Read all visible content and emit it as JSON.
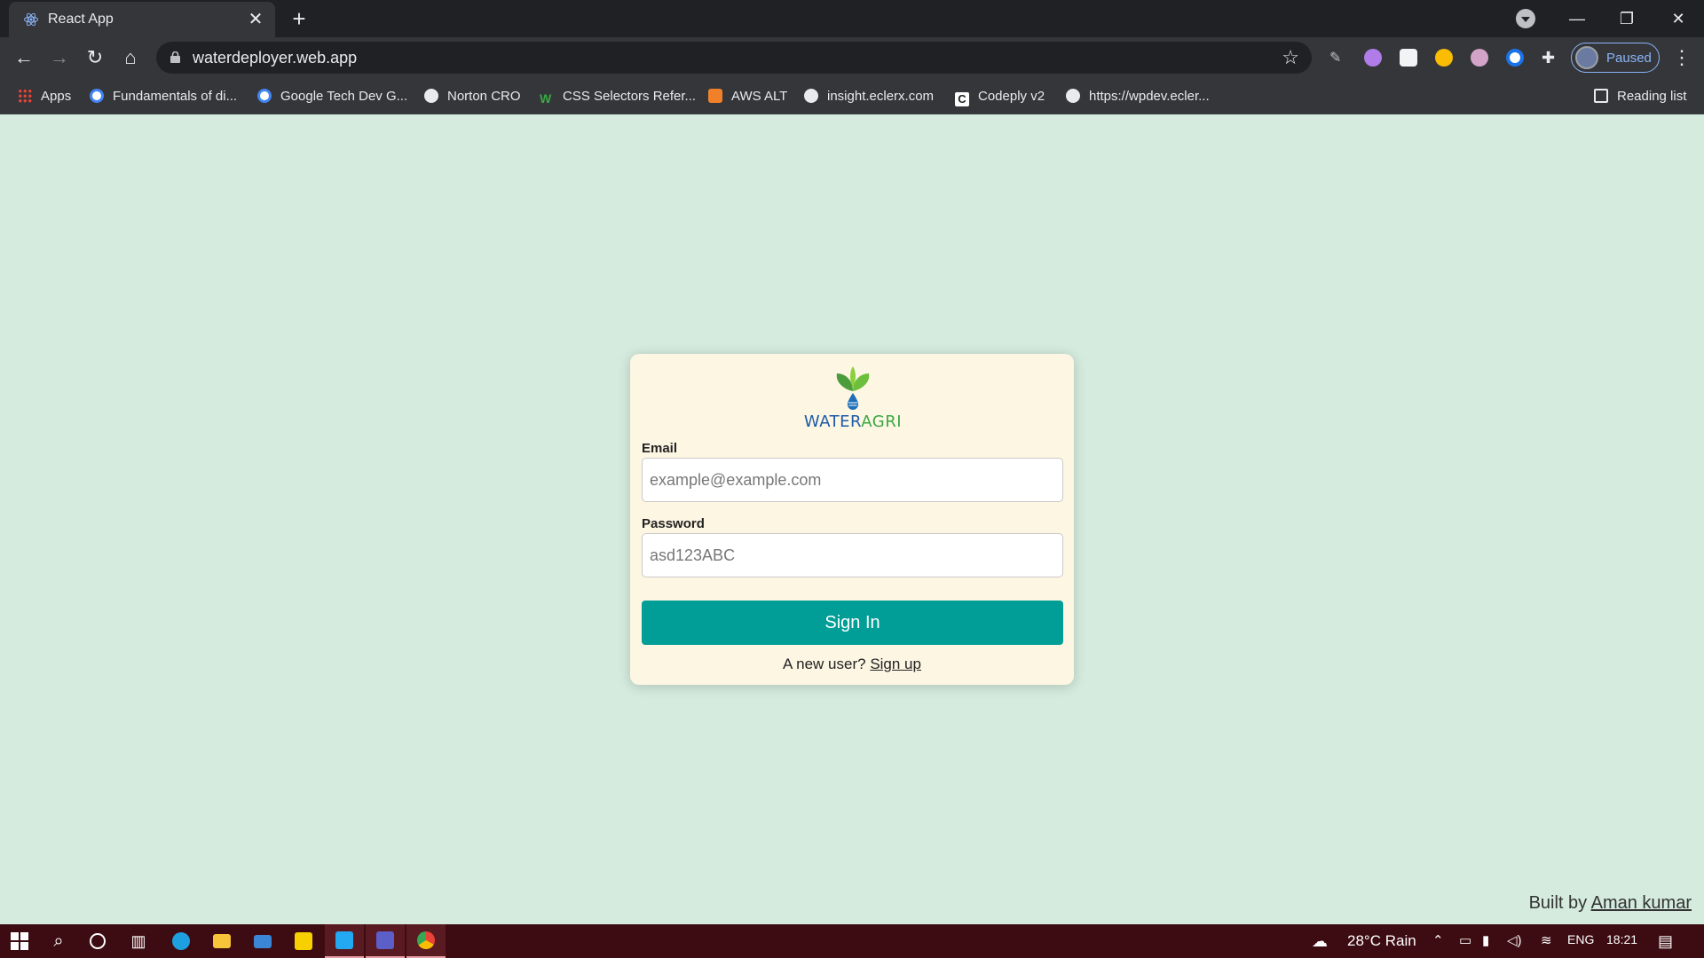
{
  "browser": {
    "tab_title": "React App",
    "tab_close": "✕",
    "new_tab": "+",
    "url": "waterdeployer.web.app",
    "profile_status": "Paused",
    "bookmarks": [
      {
        "label": "Apps",
        "icon": "apps-grid-icon"
      },
      {
        "label": "Fundamentals of di...",
        "icon": "google-icon"
      },
      {
        "label": "Google Tech Dev G...",
        "icon": "google-icon"
      },
      {
        "label": "Norton CRO",
        "icon": "globe-icon"
      },
      {
        "label": "CSS Selectors Refer...",
        "icon": "w3-icon"
      },
      {
        "label": "AWS ALT",
        "icon": "aws-icon"
      },
      {
        "label": "insight.eclerx.com",
        "icon": "globe-icon"
      },
      {
        "label": "Codeply v2",
        "icon": "codeply-icon"
      },
      {
        "label": "https://wpdev.ecler...",
        "icon": "globe-icon"
      }
    ],
    "reading_list": "Reading list"
  },
  "login": {
    "brand_left": "WATER",
    "brand_right": "AGRI",
    "email_label": "Email",
    "email_placeholder": "example@example.com",
    "password_label": "Password",
    "password_placeholder": "asd123ABC",
    "signin_label": "Sign In",
    "new_user_text": "A new user?",
    "signup_link": "Sign up"
  },
  "footer": {
    "built_by": "Built by",
    "author": "Aman kumar"
  },
  "taskbar": {
    "weather": "28°C  Rain",
    "language": "ENG",
    "time": "18:21"
  },
  "colors": {
    "page_bg": "#d4ebdd",
    "card_bg": "#fdf6e3",
    "signin_bg": "#009e96",
    "taskbar_bg": "#3d0c12"
  }
}
